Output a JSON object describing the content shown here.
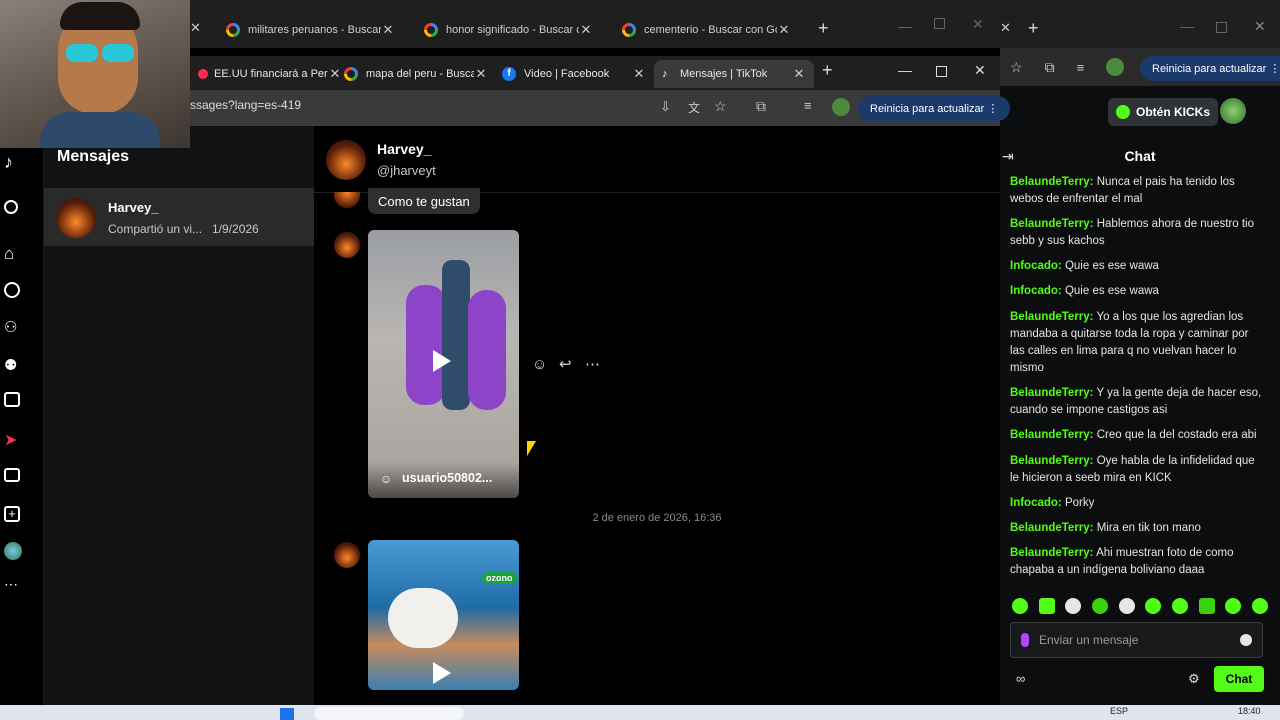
{
  "back_tabs": [
    {
      "label": "militares peruanos - Buscar co"
    },
    {
      "label": "honor significado - Buscar con"
    },
    {
      "label": "cementerio - Buscar con Googl"
    }
  ],
  "front_tabs": [
    {
      "label": "EE.UU financiará a Per"
    },
    {
      "label": "mapa del peru - Busca"
    },
    {
      "label": "Video | Facebook"
    },
    {
      "label": "Mensajes | TikTok"
    }
  ],
  "front_url": "ssages?lang=es-419",
  "update_button": "Reinicia para actualizar",
  "tiktok": {
    "title": "Mensajes",
    "conversation": {
      "name": "Harvey_",
      "preview": "Compartió un vi...",
      "date": "1/9/2026"
    },
    "header": {
      "name": "Harvey_",
      "handle": "@jharveyt"
    },
    "bubble": "Como te gustan",
    "video1_user": "usuario50802...",
    "timestamp": "2 de enero de 2026, 16:36",
    "video2_text": "ozono"
  },
  "kick": {
    "get_kicks": "Obtén KICKs",
    "chat_title": "Chat",
    "messages": [
      {
        "user": "BelaundeTerry:",
        "text": "Nunca el pais ha tenido los webos de enfrentar el mal"
      },
      {
        "user": "BelaundeTerry:",
        "text": "Hablemos ahora de nuestro tio sebb y sus kachos"
      },
      {
        "user": "Infocado:",
        "text": "Quie es ese wawa"
      },
      {
        "user": "Infocado:",
        "text": "Quie es ese wawa"
      },
      {
        "user": "BelaundeTerry:",
        "text": "Yo a los que los agredian los mandaba a quitarse toda la ropa y caminar por las calles en lima para q no vuelvan hacer lo mismo"
      },
      {
        "user": "BelaundeTerry:",
        "text": "Y ya la gente deja de hacer eso, cuando se impone castigos asi"
      },
      {
        "user": "BelaundeTerry:",
        "text": "Creo que la del costado era abi"
      },
      {
        "user": "BelaundeTerry:",
        "text": "Oye habla de la infidelidad que le hicieron a seeb mira en KICK"
      },
      {
        "user": "Infocado:",
        "text": "Porky"
      },
      {
        "user": "BelaundeTerry:",
        "text": "Mira en tik ton mano"
      },
      {
        "user": "BelaundeTerry:",
        "text": "Ahi muestran foto de como chapaba a un indígena boliviano daaa"
      }
    ],
    "input_placeholder": "Enviar un mensaje",
    "chat_button": "Chat"
  },
  "taskbar": {
    "lang": "ESP",
    "time": "18:40"
  },
  "colors": {
    "kick_green": "#53fc18",
    "tiktok_red": "#fe2c55",
    "facebook_blue": "#1877f2"
  }
}
